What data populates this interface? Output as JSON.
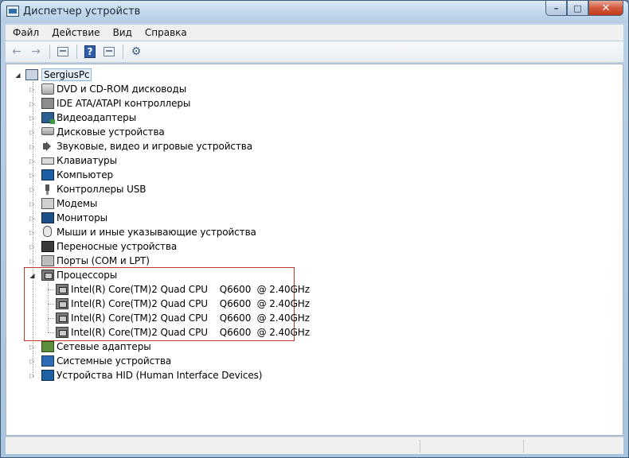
{
  "window": {
    "title": "Диспетчер устройств",
    "caption_buttons": {
      "minimize": "–",
      "maximize": "□",
      "close": "✕"
    }
  },
  "menu": [
    "Файл",
    "Действие",
    "Вид",
    "Справка"
  ],
  "toolbar": {
    "back_icon": "arrow-left",
    "forward_icon": "arrow-right",
    "properties_icon": "properties",
    "help_icon": "help",
    "view_icon": "view",
    "scan_icon": "scan-hardware"
  },
  "tree": {
    "root": "SergiusPc",
    "categories": [
      {
        "label": "DVD и CD-ROM дисководы",
        "icon": "disc-drive-icon"
      },
      {
        "label": "IDE ATA/ATAPI контроллеры",
        "icon": "ide-controller-icon"
      },
      {
        "label": "Видеоадаптеры",
        "icon": "video-adapter-icon"
      },
      {
        "label": "Дисковые устройства",
        "icon": "disk-drive-icon"
      },
      {
        "label": "Звуковые, видео и игровые устройства",
        "icon": "sound-icon"
      },
      {
        "label": "Клавиатуры",
        "icon": "keyboard-icon"
      },
      {
        "label": "Компьютер",
        "icon": "computer-icon"
      },
      {
        "label": "Контроллеры USB",
        "icon": "usb-icon"
      },
      {
        "label": "Модемы",
        "icon": "modem-icon"
      },
      {
        "label": "Мониторы",
        "icon": "monitor-icon"
      },
      {
        "label": "Мыши и иные указывающие устройства",
        "icon": "mouse-icon"
      },
      {
        "label": "Переносные устройства",
        "icon": "portable-device-icon"
      },
      {
        "label": "Порты (COM и LPT)",
        "icon": "port-icon"
      }
    ],
    "processors": {
      "label": "Процессоры",
      "expanded": true,
      "children": [
        "Intel(R) Core(TM)2 Quad CPU    Q6600  @ 2.40GHz",
        "Intel(R) Core(TM)2 Quad CPU    Q6600  @ 2.40GHz",
        "Intel(R) Core(TM)2 Quad CPU    Q6600  @ 2.40GHz",
        "Intel(R) Core(TM)2 Quad CPU    Q6600  @ 2.40GHz"
      ]
    },
    "after": [
      {
        "label": "Сетевые адаптеры",
        "icon": "network-adapter-icon"
      },
      {
        "label": "Системные устройства",
        "icon": "system-device-icon"
      },
      {
        "label": "Устройства HID (Human Interface Devices)",
        "icon": "hid-icon"
      }
    ]
  },
  "colors": {
    "highlight_border": "#c0392b",
    "root_selection": "#e4eff9"
  }
}
